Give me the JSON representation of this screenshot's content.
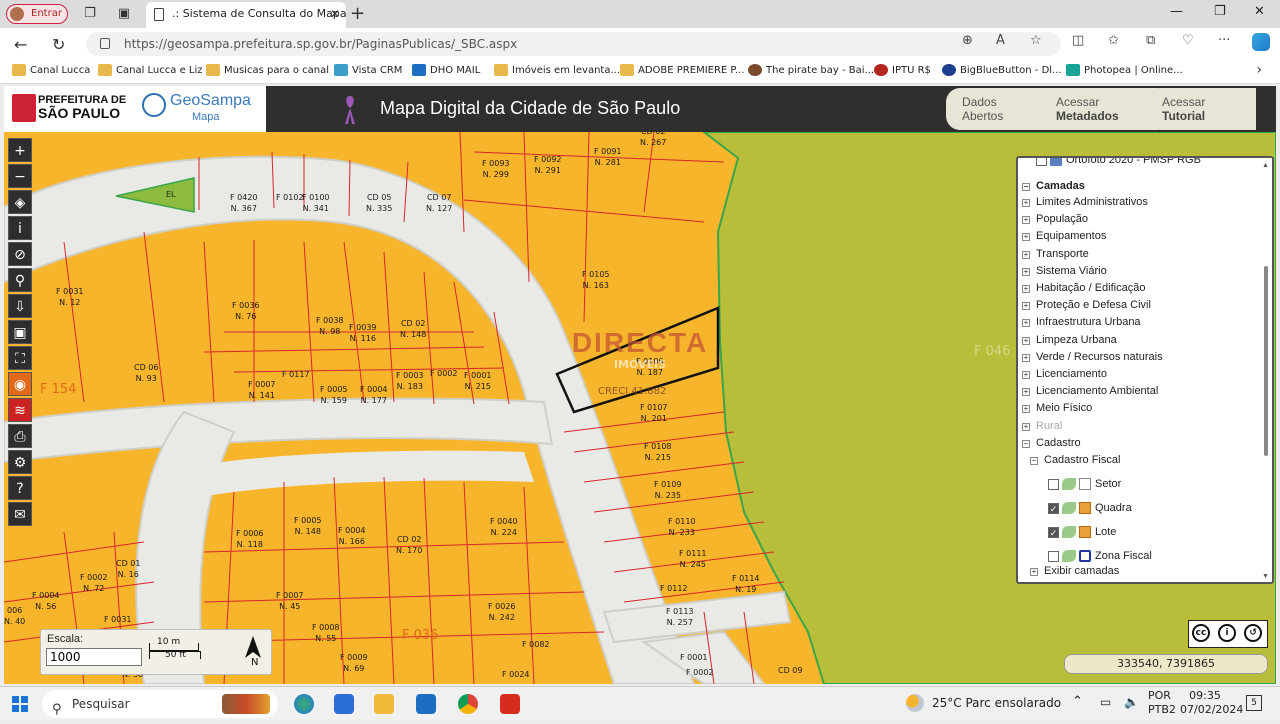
{
  "browser": {
    "profile_label": "Entrar",
    "tab_title": ".: Sistema de Consulta do Mapa D",
    "url": "https://geosampa.prefeitura.sp.gov.br/PaginasPublicas/_SBC.aspx",
    "bookmarks": [
      "Canal Lucca",
      "Canal Lucca e Liz",
      "Musicas para o canal",
      "Vista CRM",
      "DHO MAIL",
      "Imóveis em levanta...",
      "ADOBE PREMIERE P...",
      "The pirate bay - Bai...",
      "IPTU R$",
      "BigBlueButton - Dl...",
      "Photopea | Online..."
    ]
  },
  "site": {
    "pref_line1": "PREFEITURA DE",
    "pref_line2": "SÃO PAULO",
    "geo_line1": "GeoSampa",
    "geo_line2": "Mapa",
    "title": "Mapa Digital da Cidade de São Paulo",
    "buttons": [
      {
        "line1": "Dados",
        "line2": "Abertos"
      },
      {
        "line1": "Acessar",
        "line2": "Metadados"
      },
      {
        "line1": "Acessar",
        "line2": "Tutorial"
      }
    ]
  },
  "map": {
    "lots": [
      {
        "id": "F 0420",
        "n": "N. 367"
      },
      {
        "id": "F 0102",
        "n": ""
      },
      {
        "id": "F 0100",
        "n": "N. 341"
      },
      {
        "id": "CD 05",
        "n": "N. 335"
      },
      {
        "id": "CD 07",
        "n": "N. 127"
      },
      {
        "id": "F 0093",
        "n": "N. 299"
      },
      {
        "id": "F 0092",
        "n": "N. 291"
      },
      {
        "id": "F 0091",
        "n": "N. 281"
      },
      {
        "id": "CD 02",
        "n": "N. 267"
      },
      {
        "id": "F 0105",
        "n": "N. 163"
      },
      {
        "id": "F 0031",
        "n": "N. 12"
      },
      {
        "id": "F 0036",
        "n": "N. 76"
      },
      {
        "id": "F 0038",
        "n": "N. 98"
      },
      {
        "id": "F 0039",
        "n": "N. 116"
      },
      {
        "id": "CD 02",
        "n": "N. 148"
      },
      {
        "id": "CD 06",
        "n": "N. 93"
      },
      {
        "id": "F 0007",
        "n": "N. 141"
      },
      {
        "id": "F 0117",
        "n": ""
      },
      {
        "id": "F 0005",
        "n": "N. 159"
      },
      {
        "id": "F 0004",
        "n": "N. 177"
      },
      {
        "id": "F 0003",
        "n": "N. 183"
      },
      {
        "id": "F 0002",
        "n": ""
      },
      {
        "id": "F 0001",
        "n": "N. 215"
      },
      {
        "id": "F 0106",
        "n": "N. 187"
      },
      {
        "id": "F 0107",
        "n": "N. 201"
      },
      {
        "id": "F 0108",
        "n": "N. 215"
      },
      {
        "id": "F 0109",
        "n": "N. 235"
      },
      {
        "id": "F 0110",
        "n": "N. 233"
      },
      {
        "id": "F 0111",
        "n": "N. 245"
      },
      {
        "id": "F 0112",
        "n": ""
      },
      {
        "id": "F 0114",
        "n": "N. 19"
      },
      {
        "id": "F 0113",
        "n": "N. 257"
      },
      {
        "id": "F 0006",
        "n": "N. 118"
      },
      {
        "id": "F 0005",
        "n": "N. 148"
      },
      {
        "id": "F 0004",
        "n": "N. 166"
      },
      {
        "id": "CD 02",
        "n": "N. 170"
      },
      {
        "id": "F 0040",
        "n": "N. 224"
      },
      {
        "id": "CD 01",
        "n": "N. 16"
      },
      {
        "id": "F 0002",
        "n": "N. 72"
      },
      {
        "id": "F 0004",
        "n": "N. 56"
      },
      {
        "id": "F 0031",
        "n": ""
      },
      {
        "id": "F 0007",
        "n": "N. 45"
      },
      {
        "id": "F 0008",
        "n": "N. 55"
      },
      {
        "id": "F 0026",
        "n": "N. 242"
      },
      {
        "id": "F 0009",
        "n": "N. 69"
      },
      {
        "id": "F 0082",
        "n": ""
      },
      {
        "id": "F 0024",
        "n": ""
      },
      {
        "id": "F 0001",
        "n": ""
      },
      {
        "id": "F 0002",
        "n": ""
      },
      {
        "id": "CD 09",
        "n": ""
      },
      {
        "id": "006",
        "n": "N. 40"
      },
      {
        "id": "",
        "n": "N. 38"
      },
      {
        "id": "F 0030",
        "n": ""
      }
    ],
    "blocks": [
      "F 154",
      "F 036",
      "F 046"
    ],
    "el_label": "EL",
    "watermark": "DIRECTA",
    "watermark_sub": "IMÓVEIS",
    "creci": "CRECI 41.882"
  },
  "layers": {
    "top_item": "Ortofoto 2020 - PMSP RGB",
    "heading": "Camadas",
    "groups": [
      "Limites Administrativos",
      "População",
      "Equipamentos",
      "Transporte",
      "Sistema Viário",
      "Habitação / Edificação",
      "Proteção e Defesa Civil",
      "Infraestrutura Urbana",
      "Limpeza Urbana",
      "Verde / Recursos naturais",
      "Licenciamento",
      "Licenciamento Ambiental",
      "Meio Físico",
      "Rural",
      "Cadastro"
    ],
    "subgroup": "Cadastro Fiscal",
    "items": [
      {
        "label": "Setor",
        "checked": false
      },
      {
        "label": "Quadra",
        "checked": true
      },
      {
        "label": "Lote",
        "checked": true
      },
      {
        "label": "Zona Fiscal",
        "checked": false
      }
    ],
    "show_layers": "Exibir camadas"
  },
  "scale": {
    "label": "Escala:",
    "value": "1000",
    "bar_m": "10 m",
    "bar_ft": "50 ft",
    "north": "N"
  },
  "coords": "333540, 7391865",
  "taskbar": {
    "search": "Pesquisar",
    "weather": "25°C  Parc ensolarado",
    "lang1": "POR",
    "lang2": "PTB2",
    "time": "09:35",
    "date": "07/02/2024",
    "notif": "5"
  },
  "colors": {
    "lot_fill": "#f7b52c",
    "lot_line": "#d8262b",
    "street": "#e9e9e6",
    "green": "#b8bd3a"
  }
}
